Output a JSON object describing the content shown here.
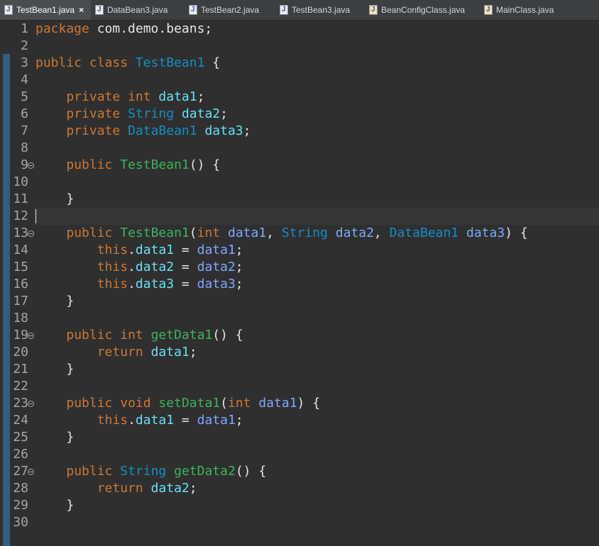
{
  "tabs": [
    {
      "label": "TestBean1.java",
      "active": true,
      "close_icon": "×",
      "icon": "java-file-icon"
    },
    {
      "label": "DataBean3.java",
      "icon": "java-file-icon"
    },
    {
      "label": "TestBean2.java",
      "icon": "java-file-icon"
    },
    {
      "label": "TestBean3.java",
      "icon": "java-file-icon"
    },
    {
      "label": "BeanConfigClass.java",
      "icon": "java-runnable-icon"
    },
    {
      "label": "MainClass.java",
      "icon": "java-runnable-icon"
    }
  ],
  "code": {
    "line_numbers": [
      "1",
      "2",
      "3",
      "4",
      "5",
      "6",
      "7",
      "8",
      "9",
      "10",
      "11",
      "12",
      "13",
      "14",
      "15",
      "16",
      "17",
      "18",
      "19",
      "20",
      "21",
      "22",
      "23",
      "24",
      "25",
      "26",
      "27",
      "28",
      "29",
      "30"
    ],
    "foldable_lines": [
      "9",
      "13",
      "19",
      "23",
      "27"
    ],
    "current_line": "12",
    "lines": [
      [
        [
          "kw",
          "package"
        ],
        [
          "pl",
          " com.demo.beans;"
        ]
      ],
      [],
      [
        [
          "kw",
          "public"
        ],
        [
          "pl",
          " "
        ],
        [
          "kw",
          "class"
        ],
        [
          "pl",
          " "
        ],
        [
          "cls",
          "TestBean1"
        ],
        [
          "pl",
          " {"
        ]
      ],
      [],
      [
        [
          "pl",
          "    "
        ],
        [
          "kw",
          "private"
        ],
        [
          "pl",
          " "
        ],
        [
          "kw",
          "int"
        ],
        [
          "pl",
          " "
        ],
        [
          "fld",
          "data1"
        ],
        [
          "pl",
          ";"
        ]
      ],
      [
        [
          "pl",
          "    "
        ],
        [
          "kw",
          "private"
        ],
        [
          "pl",
          " "
        ],
        [
          "cls",
          "String"
        ],
        [
          "pl",
          " "
        ],
        [
          "fld",
          "data2"
        ],
        [
          "pl",
          ";"
        ]
      ],
      [
        [
          "pl",
          "    "
        ],
        [
          "kw",
          "private"
        ],
        [
          "pl",
          " "
        ],
        [
          "cls",
          "DataBean1"
        ],
        [
          "pl",
          " "
        ],
        [
          "fld",
          "data3"
        ],
        [
          "pl",
          ";"
        ]
      ],
      [],
      [
        [
          "pl",
          "    "
        ],
        [
          "kw",
          "public"
        ],
        [
          "pl",
          " "
        ],
        [
          "fn",
          "TestBean1"
        ],
        [
          "pl",
          "() {"
        ]
      ],
      [],
      [
        [
          "pl",
          "    }"
        ]
      ],
      [],
      [
        [
          "pl",
          "    "
        ],
        [
          "kw",
          "public"
        ],
        [
          "pl",
          " "
        ],
        [
          "fn",
          "TestBean1"
        ],
        [
          "pl",
          "("
        ],
        [
          "kw",
          "int"
        ],
        [
          "pl",
          " "
        ],
        [
          "par",
          "data1"
        ],
        [
          "pl",
          ", "
        ],
        [
          "cls",
          "String"
        ],
        [
          "pl",
          " "
        ],
        [
          "par",
          "data2"
        ],
        [
          "pl",
          ", "
        ],
        [
          "cls",
          "DataBean1"
        ],
        [
          "pl",
          " "
        ],
        [
          "par",
          "data3"
        ],
        [
          "pl",
          ") {"
        ]
      ],
      [
        [
          "pl",
          "        "
        ],
        [
          "kw",
          "this"
        ],
        [
          "pl",
          "."
        ],
        [
          "fld",
          "data1"
        ],
        [
          "pl",
          " = "
        ],
        [
          "par",
          "data1"
        ],
        [
          "pl",
          ";"
        ]
      ],
      [
        [
          "pl",
          "        "
        ],
        [
          "kw",
          "this"
        ],
        [
          "pl",
          "."
        ],
        [
          "fld",
          "data2"
        ],
        [
          "pl",
          " = "
        ],
        [
          "par",
          "data2"
        ],
        [
          "pl",
          ";"
        ]
      ],
      [
        [
          "pl",
          "        "
        ],
        [
          "kw",
          "this"
        ],
        [
          "pl",
          "."
        ],
        [
          "fld",
          "data3"
        ],
        [
          "pl",
          " = "
        ],
        [
          "par",
          "data3"
        ],
        [
          "pl",
          ";"
        ]
      ],
      [
        [
          "pl",
          "    }"
        ]
      ],
      [],
      [
        [
          "pl",
          "    "
        ],
        [
          "kw",
          "public"
        ],
        [
          "pl",
          " "
        ],
        [
          "kw",
          "int"
        ],
        [
          "pl",
          " "
        ],
        [
          "fn",
          "getData1"
        ],
        [
          "pl",
          "() {"
        ]
      ],
      [
        [
          "pl",
          "        "
        ],
        [
          "kw",
          "return"
        ],
        [
          "pl",
          " "
        ],
        [
          "fld",
          "data1"
        ],
        [
          "pl",
          ";"
        ]
      ],
      [
        [
          "pl",
          "    }"
        ]
      ],
      [],
      [
        [
          "pl",
          "    "
        ],
        [
          "kw",
          "public"
        ],
        [
          "pl",
          " "
        ],
        [
          "kw",
          "void"
        ],
        [
          "pl",
          " "
        ],
        [
          "fn",
          "setData1"
        ],
        [
          "pl",
          "("
        ],
        [
          "kw",
          "int"
        ],
        [
          "pl",
          " "
        ],
        [
          "par",
          "data1"
        ],
        [
          "pl",
          ") {"
        ]
      ],
      [
        [
          "pl",
          "        "
        ],
        [
          "kw",
          "this"
        ],
        [
          "pl",
          "."
        ],
        [
          "fld",
          "data1"
        ],
        [
          "pl",
          " = "
        ],
        [
          "par",
          "data1"
        ],
        [
          "pl",
          ";"
        ]
      ],
      [
        [
          "pl",
          "    }"
        ]
      ],
      [],
      [
        [
          "pl",
          "    "
        ],
        [
          "kw",
          "public"
        ],
        [
          "pl",
          " "
        ],
        [
          "cls",
          "String"
        ],
        [
          "pl",
          " "
        ],
        [
          "fn",
          "getData2"
        ],
        [
          "pl",
          "() {"
        ]
      ],
      [
        [
          "pl",
          "        "
        ],
        [
          "kw",
          "return"
        ],
        [
          "pl",
          " "
        ],
        [
          "fld",
          "data2"
        ],
        [
          "pl",
          ";"
        ]
      ],
      [
        [
          "pl",
          "    }"
        ]
      ],
      []
    ]
  },
  "colors": {
    "keyword": "#cc7832",
    "class_name": "#1290c3",
    "method": "#3bb55a",
    "field": "#66e1f8",
    "parameter": "#7ea8ff",
    "background": "#2f2f2f"
  }
}
